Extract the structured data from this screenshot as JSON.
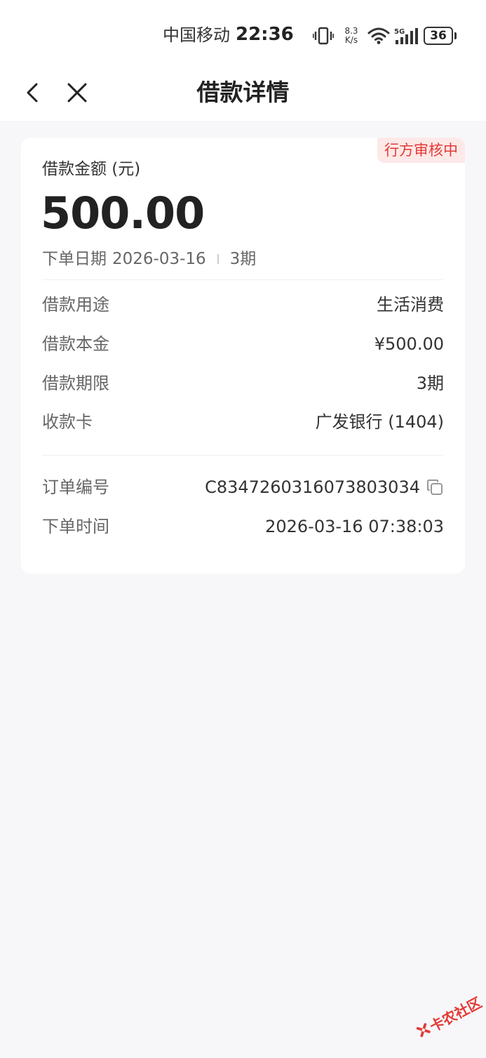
{
  "status_bar": {
    "carrier": "中国移动",
    "time": "22:36",
    "net_speed_value": "8.3",
    "net_speed_unit": "K/s",
    "network": "5G",
    "battery": "36",
    "icons": [
      "vibrate-icon",
      "wifi-icon",
      "signal-5g-icon",
      "battery-icon"
    ]
  },
  "nav": {
    "title": "借款详情",
    "back_icon": "chevron-left-icon",
    "close_icon": "close-icon"
  },
  "loan": {
    "status_tag": "行方审核中",
    "amount_label": "借款金额 (元)",
    "amount_value": "500.00",
    "order_date_label": "下单日期",
    "order_date": "2026-03-16",
    "periods_summary": "3期"
  },
  "details": [
    {
      "label": "借款用途",
      "value": "生活消费"
    },
    {
      "label": "借款本金",
      "value": "¥500.00"
    },
    {
      "label": "借款期限",
      "value": "3期"
    },
    {
      "label": "收款卡",
      "value": "广发银行 (1404)"
    }
  ],
  "order": [
    {
      "label": "订单编号",
      "value": "C834726031607380​3034",
      "copy_icon": "copy-icon"
    },
    {
      "label": "下单时间",
      "value": "2026-03-16 07:38:03"
    }
  ],
  "watermark": {
    "text": "卡农社区",
    "color": "#e53935"
  },
  "colors": {
    "accent": "#e53935",
    "tag_bg": "#fde9e8",
    "page_bg": "#f7f7f9"
  }
}
